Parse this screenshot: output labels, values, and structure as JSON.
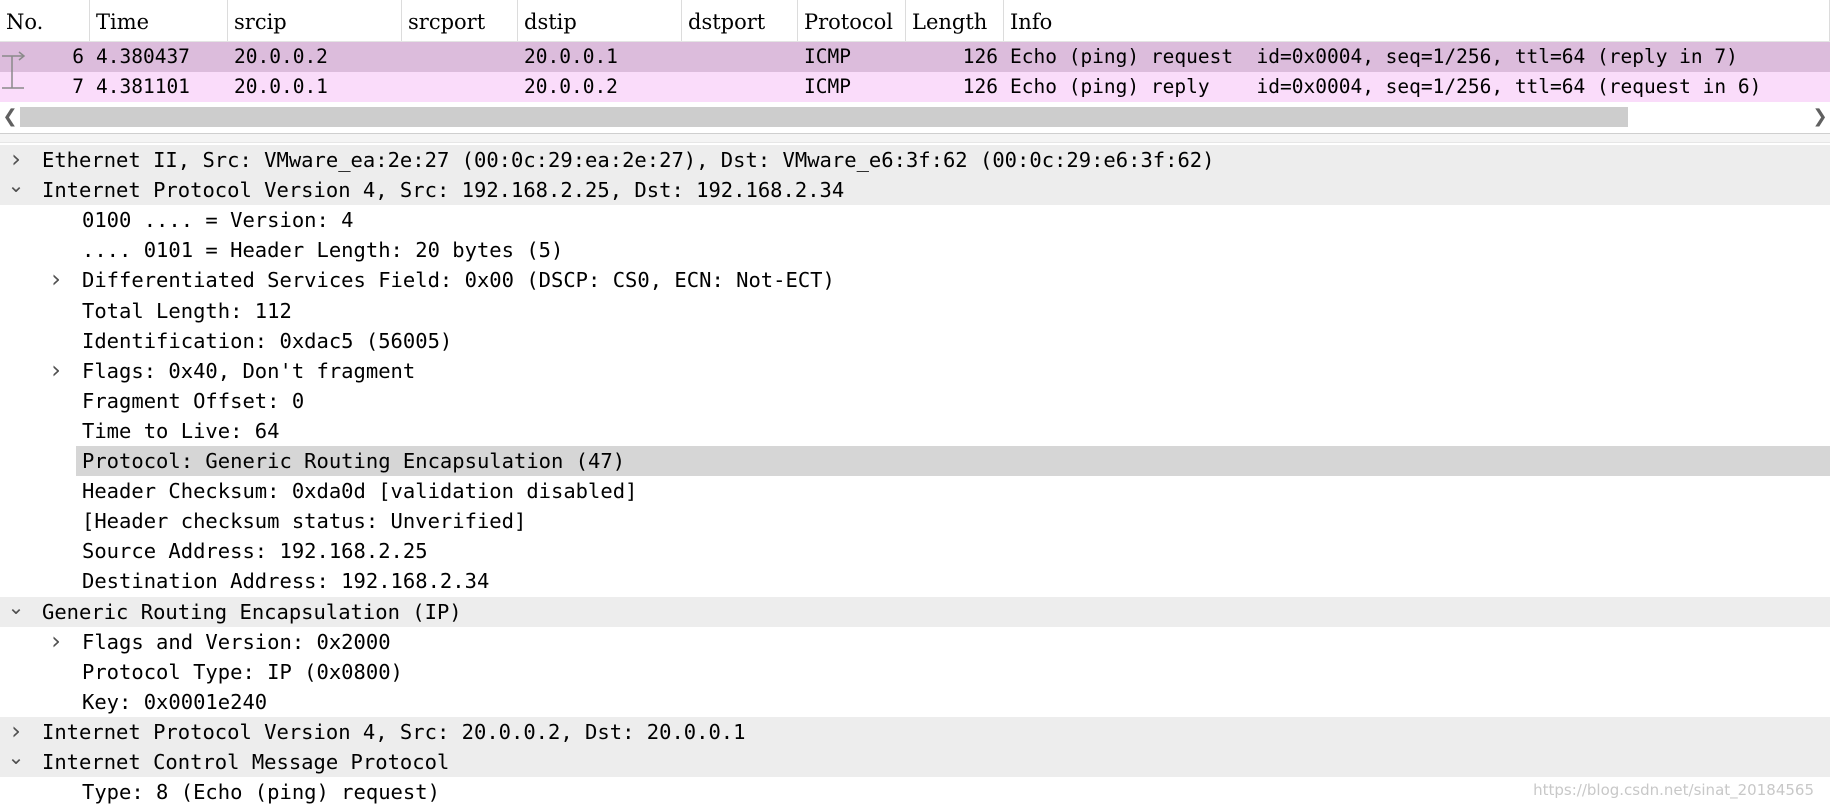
{
  "columns": [
    "No.",
    "Time",
    "srcip",
    "srcport",
    "dstip",
    "dstport",
    "Protocol",
    "Length",
    "Info"
  ],
  "colors": {
    "selected_row": "#dcbcdc",
    "row": "#fadcfa",
    "section": "#ededed",
    "highlight": "#d6d6d6"
  },
  "packets": [
    {
      "no": "6",
      "time": "4.380437",
      "srcip": "20.0.0.2",
      "srcport": "",
      "dstip": "20.0.0.1",
      "dstport": "",
      "protocol": "ICMP",
      "length": "126",
      "info": "Echo (ping) request  id=0x0004, seq=1/256, ttl=64 (reply in 7)"
    },
    {
      "no": "7",
      "time": "4.381101",
      "srcip": "20.0.0.1",
      "srcport": "",
      "dstip": "20.0.0.2",
      "dstport": "",
      "protocol": "ICMP",
      "length": "126",
      "info": "Echo (ping) reply    id=0x0004, seq=1/256, ttl=64 (request in 6)"
    }
  ],
  "scroll": {
    "left_icon": "chevron-left-icon",
    "right_icon": "chevron-right-icon"
  },
  "details": [
    {
      "text": "Ethernet II, Src: VMware_ea:2e:27 (00:0c:29:ea:2e:27), Dst: VMware_e6:3f:62 (00:0c:29:e6:3f:62)",
      "level": 0,
      "toggle": "collapsed"
    },
    {
      "text": "Internet Protocol Version 4, Src: 192.168.2.25, Dst: 192.168.2.34",
      "level": 0,
      "toggle": "expanded"
    },
    {
      "text": "0100 .... = Version: 4",
      "level": 1,
      "toggle": "none"
    },
    {
      "text": ".... 0101 = Header Length: 20 bytes (5)",
      "level": 1,
      "toggle": "none"
    },
    {
      "text": "Differentiated Services Field: 0x00 (DSCP: CS0, ECN: Not-ECT)",
      "level": 1,
      "toggle": "collapsed"
    },
    {
      "text": "Total Length: 112",
      "level": 1,
      "toggle": "none"
    },
    {
      "text": "Identification: 0xdac5 (56005)",
      "level": 1,
      "toggle": "none"
    },
    {
      "text": "Flags: 0x40, Don't fragment",
      "level": 1,
      "toggle": "collapsed"
    },
    {
      "text": "Fragment Offset: 0",
      "level": 1,
      "toggle": "none"
    },
    {
      "text": "Time to Live: 64",
      "level": 1,
      "toggle": "none"
    },
    {
      "text": "Protocol: Generic Routing Encapsulation (47)",
      "level": 1,
      "toggle": "none",
      "highlighted": true
    },
    {
      "text": "Header Checksum: 0xda0d [validation disabled]",
      "level": 1,
      "toggle": "none"
    },
    {
      "text": "[Header checksum status: Unverified]",
      "level": 1,
      "toggle": "none"
    },
    {
      "text": "Source Address: 192.168.2.25",
      "level": 1,
      "toggle": "none"
    },
    {
      "text": "Destination Address: 192.168.2.34",
      "level": 1,
      "toggle": "none"
    },
    {
      "text": "Generic Routing Encapsulation (IP)",
      "level": 0,
      "toggle": "expanded"
    },
    {
      "text": "Flags and Version: 0x2000",
      "level": 1,
      "toggle": "collapsed"
    },
    {
      "text": "Protocol Type: IP (0x0800)",
      "level": 1,
      "toggle": "none"
    },
    {
      "text": "Key: 0x0001e240",
      "level": 1,
      "toggle": "none"
    },
    {
      "text": "Internet Protocol Version 4, Src: 20.0.0.2, Dst: 20.0.0.1",
      "level": 0,
      "toggle": "collapsed"
    },
    {
      "text": "Internet Control Message Protocol",
      "level": 0,
      "toggle": "expanded"
    },
    {
      "text": "Type: 8 (Echo (ping) request)",
      "level": 1,
      "toggle": "none"
    }
  ],
  "watermark": "https://blog.csdn.net/sinat_20184565"
}
